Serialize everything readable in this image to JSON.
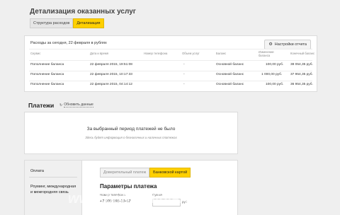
{
  "page": {
    "title": "Детализация оказанных услуг",
    "tabs": [
      {
        "label": "Структура расходов",
        "active": false
      },
      {
        "label": "Детализация",
        "active": true
      }
    ]
  },
  "expenses": {
    "caption": "Расходы за сегодня, 22 февраля в рублях",
    "settings_label": "Настройки отчета",
    "columns": [
      "Сервис",
      "Дата и время",
      "Номер телефона",
      "Объем услуг",
      "Баланс",
      "Изменение баланса",
      "Конечный баланс"
    ],
    "rows": [
      {
        "service": "Пополнение баланса",
        "datetime": "22 февраля 2015, 19:51:08",
        "phone": "",
        "volume": "-",
        "balance": "Основной баланс",
        "change": "100,00 руб.",
        "final": "38 054,35 руб."
      },
      {
        "service": "Пополнение баланса",
        "datetime": "22 февраля 2015, 10:17:33",
        "phone": "",
        "volume": "-",
        "balance": "Основной баланс",
        "change": "1 000,00 руб.",
        "final": "37 954,35 руб."
      },
      {
        "service": "Пополнение баланса",
        "datetime": "22 февраля 2015, 04:14:12",
        "phone": "",
        "volume": "-",
        "balance": "Основной баланс",
        "change": "100,00 руб.",
        "final": "36 954,35 руб."
      }
    ]
  },
  "payments": {
    "title": "Платежи",
    "refresh_label": "Обновить данные",
    "empty_title": "За выбранный период платежей не было",
    "empty_subtitle": "Здесь будет информация о безналичных и наличных платежах"
  },
  "pay_form": {
    "menu": [
      "Оплата",
      "Роуминг, международная и межгородняя связь"
    ],
    "tabs": [
      {
        "label": "Доверительный платеж",
        "active": false
      },
      {
        "label": "Банковской картой",
        "active": true
      }
    ],
    "title": "Параметры платежа",
    "phone_hint": "Номер телефона",
    "phone_value": "+7 909 998-19-67",
    "amount_hint": "Сумма",
    "amount_suffix": "руб"
  },
  "watermark": "www.baby.ru/u/alysik79"
}
